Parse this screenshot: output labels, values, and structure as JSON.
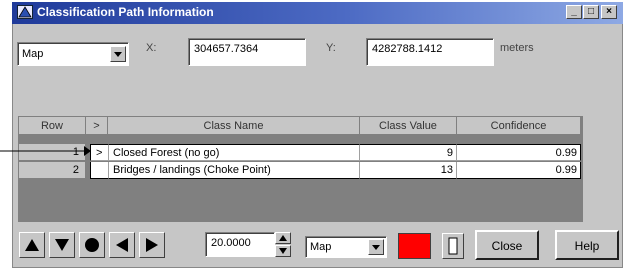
{
  "window": {
    "title": "Classification Path Information",
    "controls": {
      "minimize": "_",
      "maximize": "□",
      "close": "×"
    }
  },
  "coords": {
    "mode_value": "Map",
    "x_label": "X:",
    "x_value": "304657.7364",
    "y_label": "Y:",
    "y_value": "4282788.1412",
    "units": "meters"
  },
  "table": {
    "columns": {
      "row": "Row",
      "select": ">",
      "class_name": "Class Name",
      "class_value": "Class Value",
      "confidence": "Confidence"
    },
    "rows": [
      {
        "row": "1",
        "select": ">",
        "class_name": "Closed Forest (no go)",
        "class_value": "9",
        "confidence": "0.99"
      },
      {
        "row": "2",
        "select": "",
        "class_name": "Bridges / landings (Choke Point)",
        "class_value": "13",
        "confidence": "0.99"
      }
    ]
  },
  "toolbar": {
    "icons": [
      "up-arrow-icon",
      "down-arrow-icon",
      "circle-icon",
      "left-arrow-icon",
      "right-arrow-icon"
    ],
    "step_value": "20.0000",
    "mode_value": "Map",
    "color_swatch": "#ff0000",
    "close_label": "Close",
    "help_label": "Help"
  }
}
